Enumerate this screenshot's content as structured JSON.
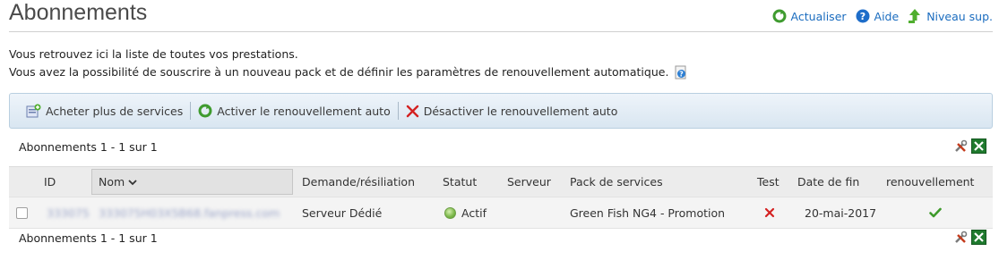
{
  "page": {
    "title": "Abonnements",
    "links": {
      "refresh": "Actualiser",
      "help": "Aide",
      "up": "Niveau sup."
    },
    "intro_line1": "Vous retrouvez ici la liste de toutes vos prestations.",
    "intro_line2": "Vous avez la possibilité de souscrire à un nouveau pack et de définir les paramètres de renouvellement automatique."
  },
  "toolbar": {
    "buy": "Acheter plus de services",
    "enable_auto": "Activer le renouvellement auto",
    "disable_auto": "Désactiver le renouvellement auto"
  },
  "pagination": {
    "summary": "Abonnements 1 - 1 sur 1"
  },
  "table": {
    "columns": {
      "id": "ID",
      "name": "Nom",
      "request": "Demande/résiliation",
      "status": "Statut",
      "server": "Serveur",
      "pack": "Pack de services",
      "test": "Test",
      "end_date": "Date de fin",
      "renewal": "renouvellement"
    },
    "rows": [
      {
        "id": "333075",
        "name": "333075H03X5B68.fanpress.com",
        "request": "Serveur Dédié",
        "status": "Actif",
        "server": "",
        "pack": "Green Fish NG4 - Promotion",
        "test": false,
        "end_date": "20-mai-2017",
        "renewal": true
      }
    ]
  },
  "colors": {
    "link": "#1a6cbf",
    "toolbar_border": "#b9cfe0",
    "status_green": "#7ab648",
    "cross_red": "#d42121",
    "check_green": "#3e9a2b"
  },
  "icons": {
    "refresh": "refresh-icon",
    "help": "help-icon",
    "up": "level-up-icon",
    "info": "info-icon",
    "buy": "add-service-icon",
    "enable": "refresh-icon",
    "disable": "cross-icon",
    "tools": "tools-icon",
    "excel": "excel-export-icon",
    "sort": "sort-desc-icon",
    "status": "status-active-icon",
    "test": "cross-icon",
    "renewal": "check-icon"
  }
}
